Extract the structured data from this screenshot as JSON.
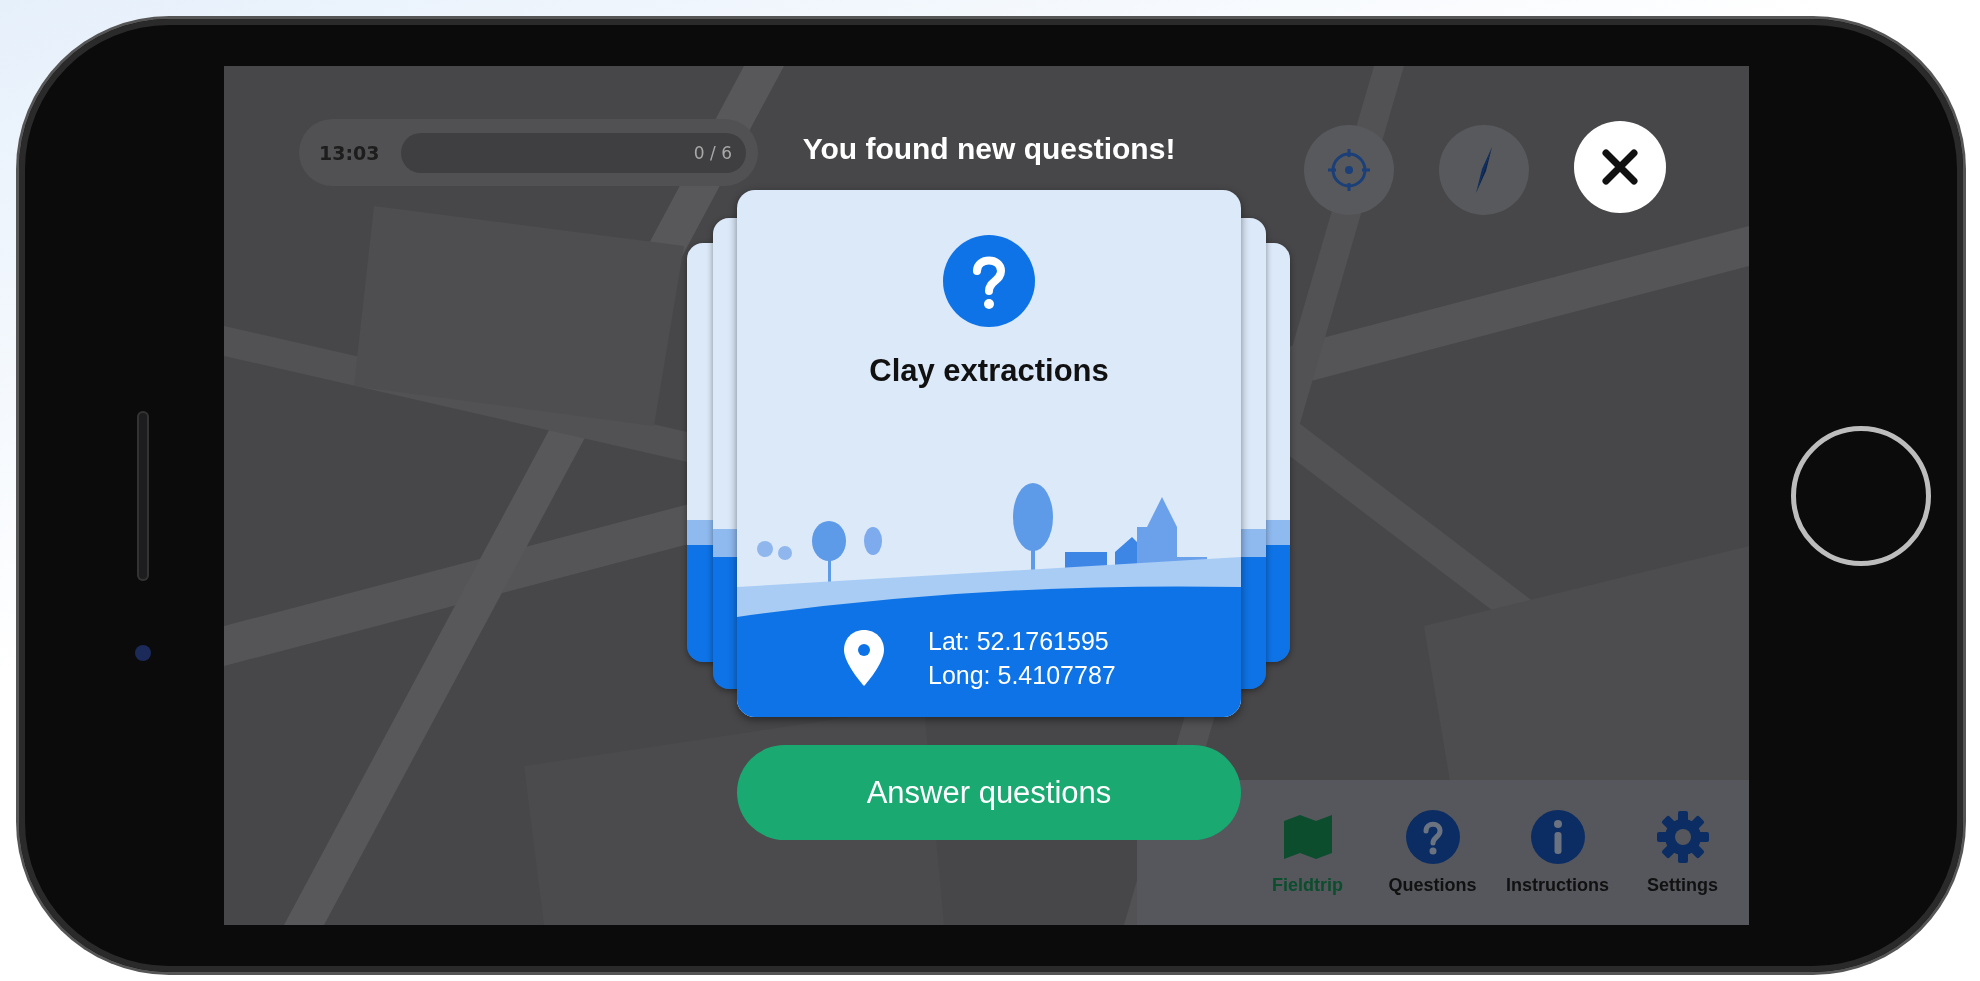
{
  "status": {
    "time": "13:03",
    "progress": "0 / 6"
  },
  "title": "You found new questions!",
  "card": {
    "title": "Clay extractions",
    "lat": "Lat: 52.1761595",
    "long": "Long: 5.4107787"
  },
  "primary_button": "Answer questions",
  "nav": [
    {
      "label": "Fieldtrip",
      "kind": "map",
      "selected": true
    },
    {
      "label": "Questions",
      "kind": "question",
      "selected": false
    },
    {
      "label": "Instructions",
      "kind": "info",
      "selected": false
    },
    {
      "label": "Settings",
      "kind": "gear",
      "selected": false
    }
  ]
}
